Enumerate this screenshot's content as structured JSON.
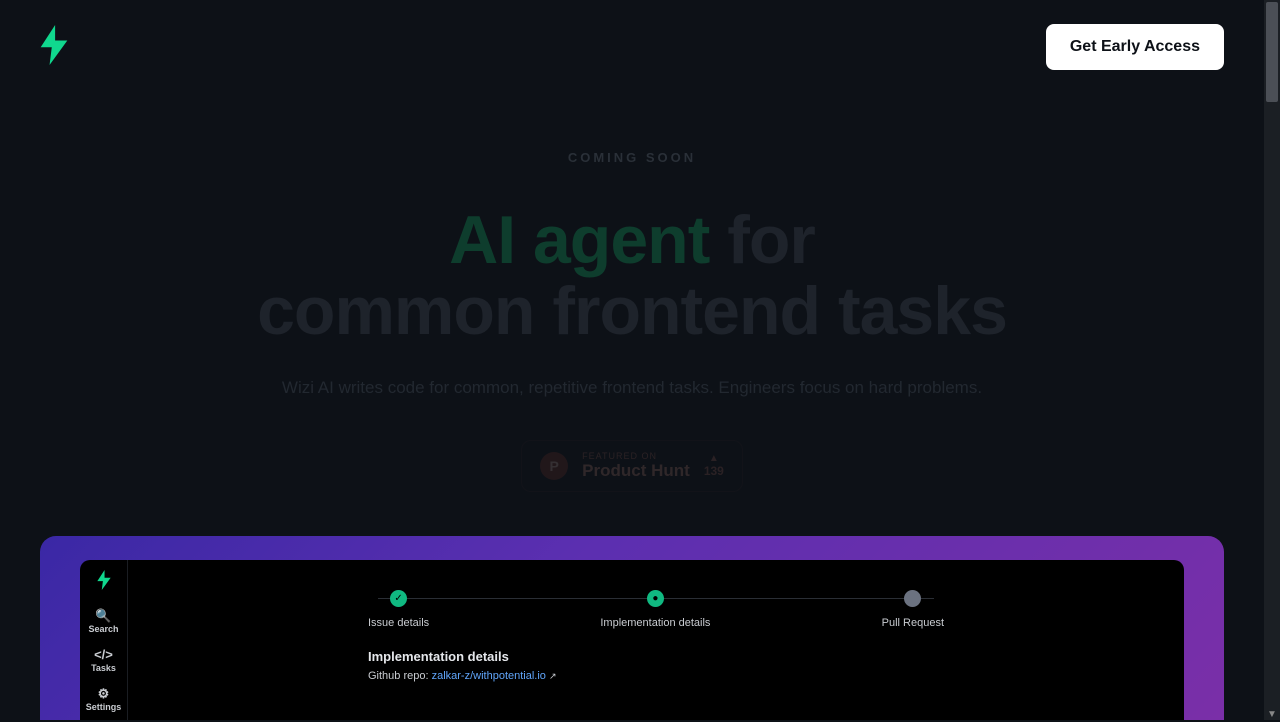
{
  "header": {
    "cta_label": "Get Early Access"
  },
  "hero": {
    "pill": "COMING SOON",
    "title_accent": "AI agent",
    "title_rest_1": " for",
    "title_line2": "common frontend tasks",
    "sub": "Wizi AI writes code for common, repetitive frontend tasks. Engineers focus on hard problems."
  },
  "product_hunt": {
    "letter": "P",
    "featured": "FEATURED ON",
    "name": "Product Hunt",
    "votes": "139"
  },
  "preview": {
    "sidebar": [
      {
        "icon": "🔍",
        "label": "Search"
      },
      {
        "icon": "</>",
        "label": "Tasks"
      },
      {
        "icon": "⚙",
        "label": "Settings"
      }
    ],
    "steps": [
      {
        "label": "Issue details",
        "state": "done"
      },
      {
        "label": "Implementation details",
        "state": "active"
      },
      {
        "label": "Pull Request",
        "state": "pending"
      }
    ],
    "section_title": "Implementation details",
    "meta_label": "Github repo: ",
    "meta_link": "zalkar-z/withpotential.io"
  },
  "colors": {
    "accent": "#10b981"
  }
}
